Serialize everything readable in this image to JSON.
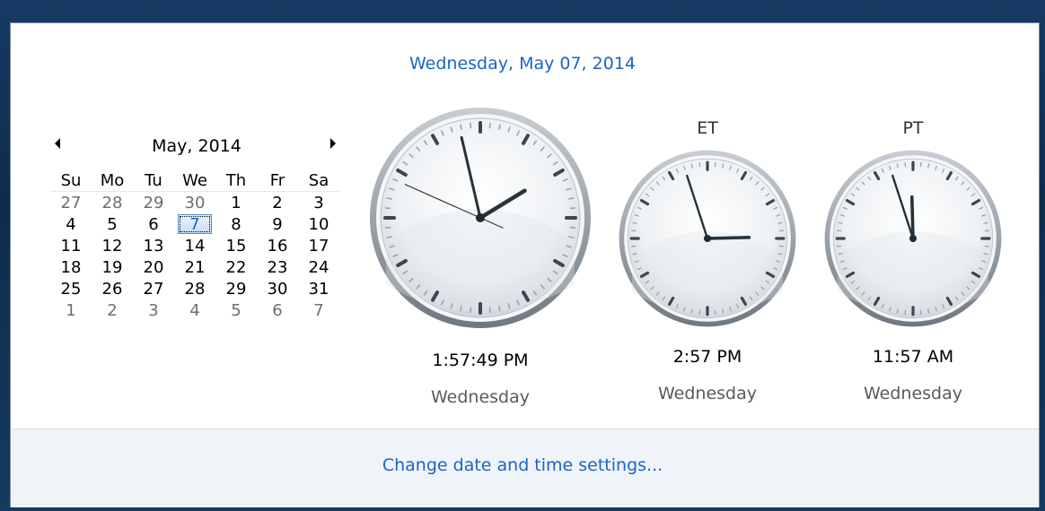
{
  "header": {
    "date": "Wednesday, May 07, 2014"
  },
  "calendar": {
    "month_label": "May, 2014",
    "weekdays": [
      "Su",
      "Mo",
      "Tu",
      "We",
      "Th",
      "Fr",
      "Sa"
    ],
    "weeks": [
      [
        {
          "d": "27",
          "other": true
        },
        {
          "d": "28",
          "other": true
        },
        {
          "d": "29",
          "other": true
        },
        {
          "d": "30",
          "other": true
        },
        {
          "d": "1"
        },
        {
          "d": "2"
        },
        {
          "d": "3"
        }
      ],
      [
        {
          "d": "4"
        },
        {
          "d": "5"
        },
        {
          "d": "6"
        },
        {
          "d": "7",
          "today": true
        },
        {
          "d": "8"
        },
        {
          "d": "9"
        },
        {
          "d": "10"
        }
      ],
      [
        {
          "d": "11"
        },
        {
          "d": "12"
        },
        {
          "d": "13"
        },
        {
          "d": "14"
        },
        {
          "d": "15"
        },
        {
          "d": "16"
        },
        {
          "d": "17"
        }
      ],
      [
        {
          "d": "18"
        },
        {
          "d": "19"
        },
        {
          "d": "20"
        },
        {
          "d": "21"
        },
        {
          "d": "22"
        },
        {
          "d": "23"
        },
        {
          "d": "24"
        }
      ],
      [
        {
          "d": "25"
        },
        {
          "d": "26"
        },
        {
          "d": "27"
        },
        {
          "d": "28"
        },
        {
          "d": "29"
        },
        {
          "d": "30"
        },
        {
          "d": "31"
        }
      ],
      [
        {
          "d": "1",
          "other": true
        },
        {
          "d": "2",
          "other": true
        },
        {
          "d": "3",
          "other": true
        },
        {
          "d": "4",
          "other": true
        },
        {
          "d": "5",
          "other": true
        },
        {
          "d": "6",
          "other": true
        },
        {
          "d": "7",
          "other": true
        }
      ]
    ]
  },
  "clocks": {
    "local": {
      "label": "",
      "time": "1:57:49 PM",
      "day": "Wednesday",
      "hour": 13,
      "minute": 57,
      "second": 49
    },
    "et": {
      "label": "ET",
      "time": "2:57 PM",
      "day": "Wednesday",
      "hour": 14,
      "minute": 57
    },
    "pt": {
      "label": "PT",
      "time": "11:57 AM",
      "day": "Wednesday",
      "hour": 11,
      "minute": 57
    }
  },
  "footer": {
    "link": "Change date and time settings..."
  },
  "colors": {
    "link": "#1a64c8",
    "today_bg": "#c7dff8"
  }
}
